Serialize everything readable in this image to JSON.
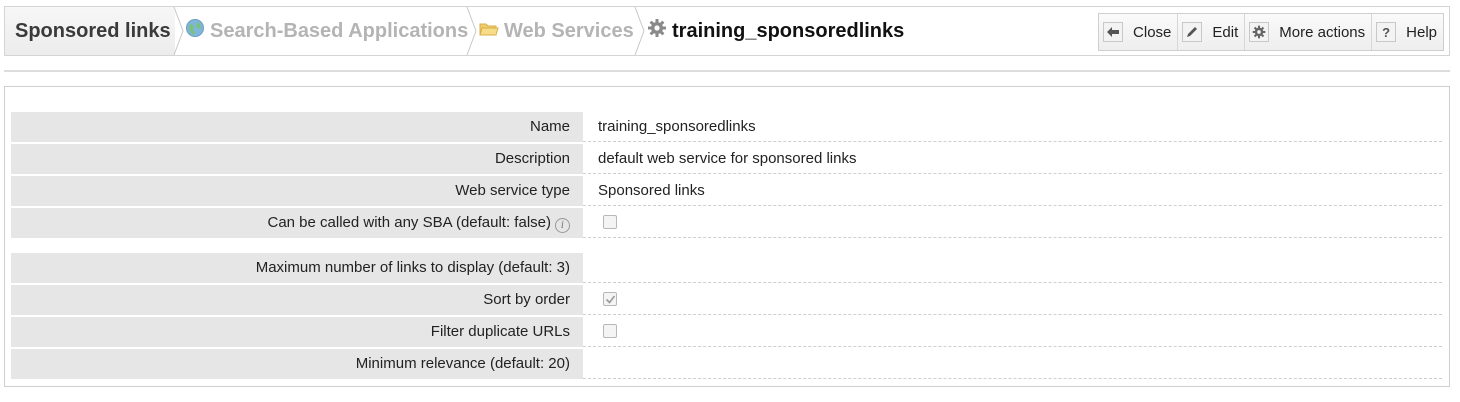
{
  "breadcrumb": {
    "root": "Sponsored links",
    "items": [
      {
        "label": "Search-Based Applications",
        "icon": "globe-icon"
      },
      {
        "label": "Web Services",
        "icon": "folder-icon"
      }
    ],
    "current": {
      "label": "training_sponsoredlinks",
      "icon": "gear-icon"
    }
  },
  "actions": [
    {
      "label": "Close",
      "icon": "close-arrow-icon"
    },
    {
      "label": "Edit",
      "icon": "pencil-icon"
    },
    {
      "label": "More actions",
      "icon": "gear-icon"
    },
    {
      "label": "Help",
      "icon": "help-icon"
    }
  ],
  "form": {
    "name": {
      "label": "Name",
      "value": "training_sponsoredlinks"
    },
    "description": {
      "label": "Description",
      "value": "default web service for sponsored links"
    },
    "type": {
      "label": "Web service type",
      "value": "Sponsored links"
    },
    "any_sba": {
      "label": "Can be called with any SBA (default: false)",
      "checked": false
    },
    "max_links": {
      "label": "Maximum number of links to display (default: 3)",
      "value": ""
    },
    "sort_by_order": {
      "label": "Sort by order",
      "checked": true
    },
    "filter_duplicates": {
      "label": "Filter duplicate URLs",
      "checked": false
    },
    "min_relevance": {
      "label": "Minimum relevance (default: 20)",
      "value": ""
    }
  },
  "colors": {
    "label_bg": "#e6e6e6",
    "crumb_grey": "#b4b4b4",
    "border": "#cfcfcf"
  }
}
